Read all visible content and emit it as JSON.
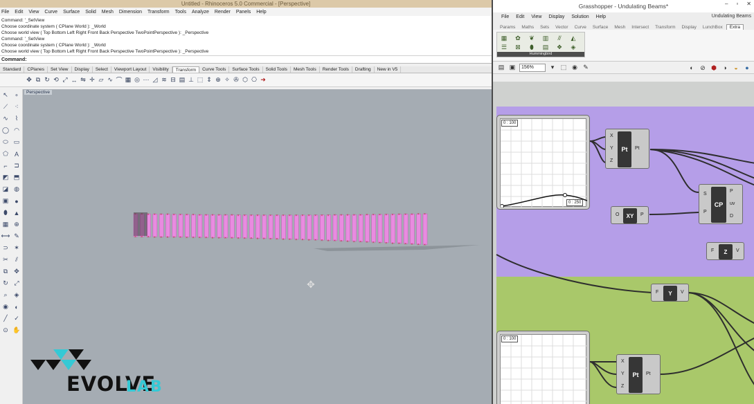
{
  "rhino": {
    "title": "Untitled - Rhinoceros 5.0 Commercial - [Perspective]",
    "menu": [
      "File",
      "Edit",
      "View",
      "Curve",
      "Surface",
      "Solid",
      "Mesh",
      "Dimension",
      "Transform",
      "Tools",
      "Analyze",
      "Render",
      "Panels",
      "Help"
    ],
    "history": [
      "Command: '_SetView",
      "Choose coordinate system ( CPlane  World ): _World",
      "Choose world view ( Top  Bottom  Left  Right  Front  Back  Perspective  TwoPointPerspective ): _Perspective",
      "Command: '_SetView",
      "Choose coordinate system ( CPlane  World ): _World",
      "Choose world view ( Top  Bottom  Left  Right  Front  Back  Perspective  TwoPointPerspective ): _Perspective"
    ],
    "prompt": "Command:",
    "tabs": [
      "Standard",
      "CPlanes",
      "Set View",
      "Display",
      "Select",
      "Viewport Layout",
      "Visibility",
      "Transform",
      "Curve Tools",
      "Surface Tools",
      "Solid Tools",
      "Mesh Tools",
      "Render Tools",
      "Drafting",
      "New in V5"
    ],
    "active_tab": "Transform",
    "viewport_label": "Perspective",
    "beam_color": "#e98be0",
    "viewport_bg": "#a5acb3"
  },
  "logo": {
    "word": "EVOLVE",
    "suffix": "LAB",
    "accent": "#35c9d5"
  },
  "grasshopper": {
    "title": "Grasshopper - Undulating Beams*",
    "menu": [
      "File",
      "Edit",
      "View",
      "Display",
      "Solution",
      "Help"
    ],
    "document": "Undulating Beams",
    "tabs": [
      "Params",
      "Maths",
      "Sets",
      "Vector",
      "Curve",
      "Surface",
      "Mesh",
      "Intersect",
      "Transform",
      "Display",
      "LunchBox",
      "Extra"
    ],
    "active_tab": "Extra",
    "panel_label": "Hummingbird",
    "zoom": "156%",
    "group_colors": {
      "purple": "#b59ee8",
      "green": "#a9c86a"
    },
    "graph1": {
      "top_label": "0 : 100",
      "bottom_label": "0 : 250"
    },
    "graph2": {
      "top_label": "0 : 100"
    },
    "pt_node": {
      "label": "Pt",
      "inputs": [
        "X",
        "Y",
        "Z"
      ],
      "output": "Pt"
    },
    "xy_node": {
      "label": "XY",
      "input": "O",
      "output": "P"
    },
    "cp_node": {
      "label": "CP",
      "inputs": [
        "S",
        "P"
      ],
      "outputs": [
        "P",
        "uv",
        "D"
      ]
    },
    "z_node": {
      "label": "Z",
      "input": "F",
      "output": "V"
    },
    "y_node": {
      "label": "Y",
      "input": "F",
      "output": "V"
    },
    "pt_node2": {
      "label": "Pt",
      "inputs": [
        "X",
        "Y",
        "Z"
      ],
      "output": "Pt"
    }
  }
}
